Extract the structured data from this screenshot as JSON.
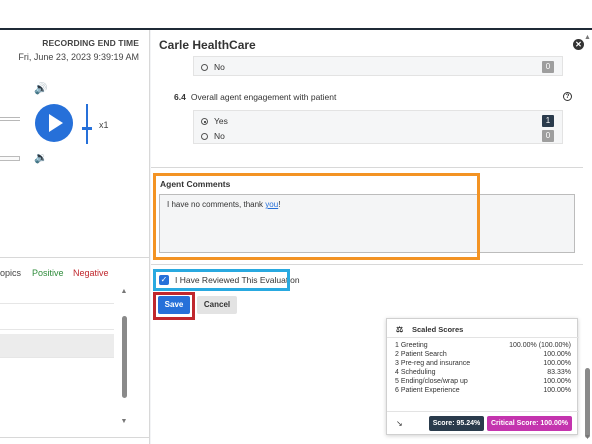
{
  "left": {
    "recording_end_label": "RECORDING END TIME",
    "recording_end_value": "Fri, June 23, 2023 9:39:19 AM",
    "speed": "x1",
    "tabs": {
      "topics": "opics",
      "positive": "Positive",
      "negative": "Negative"
    }
  },
  "panel": {
    "title": "Carle HealthCare",
    "q_prev": {
      "option_no": "No",
      "score_no": "0"
    },
    "q64": {
      "number": "6.4",
      "text": "Overall agent engagement with patient",
      "option_yes": "Yes",
      "score_yes": "1",
      "option_no": "No",
      "score_no": "0"
    },
    "comments_label": "Agent Comments",
    "comments_text_before": "I have no comments, thank ",
    "comments_text_link": "you",
    "comments_text_after": "!",
    "review_label": "I Have Reviewed This Evaluation",
    "save": "Save",
    "cancel": "Cancel"
  },
  "scores": {
    "title": "Scaled Scores",
    "rows": [
      {
        "name": "1 Greeting",
        "value": "100.00% (100.00%)"
      },
      {
        "name": "2 Patient Search",
        "value": "100.00%"
      },
      {
        "name": "3 Pre-reg and insurance",
        "value": "100.00%"
      },
      {
        "name": "4 Scheduling",
        "value": "83.33%"
      },
      {
        "name": "5 Ending/close/wrap up",
        "value": "100.00%"
      },
      {
        "name": "6 Patient Experience",
        "value": "100.00%"
      }
    ],
    "total": "Score: 95.24%",
    "critical": "Critical Score: 100.00%"
  },
  "colors": {
    "accent": "#2670d9",
    "highlight_comments": "#f39323",
    "highlight_review": "#29a9e0",
    "highlight_save": "#c0272d",
    "critical": "#c434ae",
    "positive": "#2e8b3a",
    "negative": "#c0272d"
  }
}
